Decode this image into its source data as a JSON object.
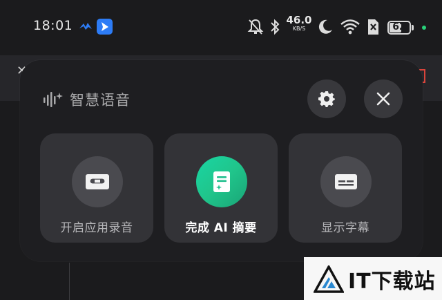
{
  "status_bar": {
    "time": "18:01",
    "net_speed_value": "46.0",
    "net_speed_unit": "KB/S",
    "battery_level": "62",
    "icons": [
      "app-bird-icon",
      "app-arrow-icon",
      "silent-bell-icon",
      "bluetooth-icon",
      "moon-icon",
      "wifi-icon",
      "sim-blocked-icon",
      "battery-icon"
    ]
  },
  "panel": {
    "title": "智慧语音",
    "title_icon": "voice-wave-icon",
    "settings_icon": "gear-icon",
    "close_icon": "close-icon",
    "tiles": [
      {
        "label": "开启应用录音",
        "icon": "cassette-icon",
        "active": false
      },
      {
        "label": "完成 AI 摘要",
        "icon": "ai-summary-icon",
        "active": true
      },
      {
        "label": "显示字幕",
        "icon": "subtitle-icon",
        "active": false
      }
    ]
  },
  "watermark": {
    "text": "IT下载站"
  },
  "colors": {
    "accent_gradient_start": "#19d6a4",
    "accent_gradient_end": "#1aa476",
    "panel_bg": "#1e1e21",
    "tile_bg": "#333337"
  }
}
